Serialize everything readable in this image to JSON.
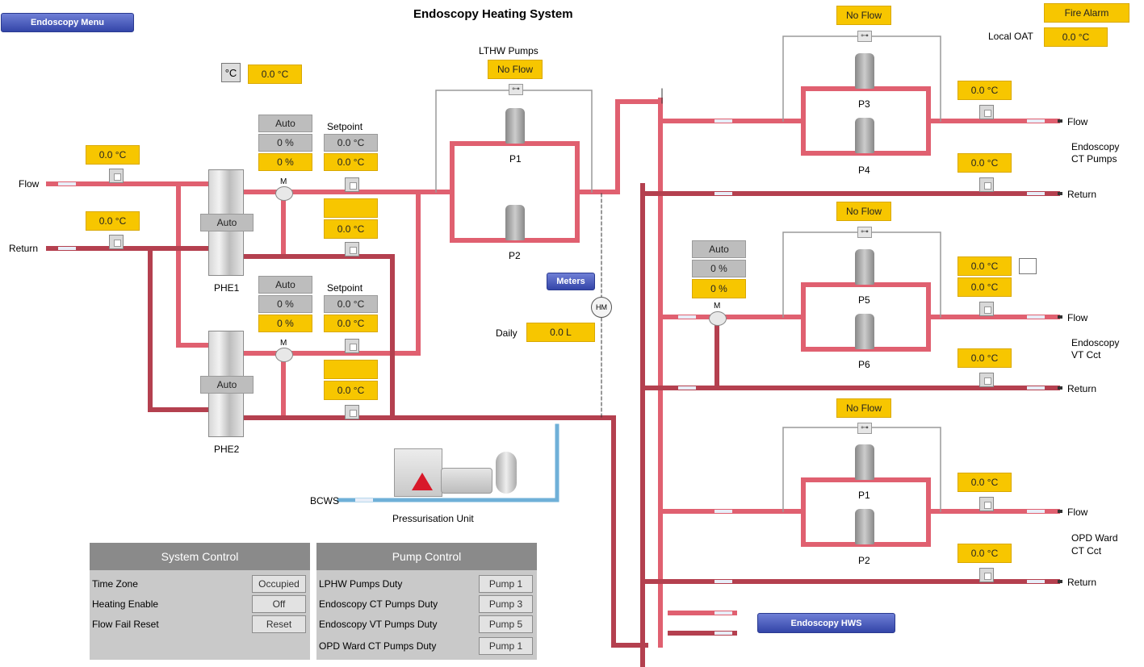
{
  "title": "Endoscopy Heating System",
  "menu_button": "Endoscopy Menu",
  "fire_alarm": "Fire Alarm",
  "local_oat": {
    "label": "Local OAT",
    "value": "0.0 °C"
  },
  "deg_icon": "°C",
  "top_temp": "0.0 °C",
  "flow_label": "Flow",
  "return_label": "Return",
  "phe_flow_temp": "0.0 °C",
  "phe_return_temp": "0.0 °C",
  "phe1": {
    "name": "PHE1",
    "mode": "Auto",
    "valve_auto": "Auto",
    "valve_pct": "0 %",
    "valve_out": "0 %",
    "setpoint_label": "Setpoint",
    "setpoint": "0.0 °C",
    "actual": "0.0 °C",
    "blank": "",
    "out_temp": "0.0 °C"
  },
  "phe2": {
    "name": "PHE2",
    "mode": "Auto",
    "valve_auto": "Auto",
    "valve_pct": "0 %",
    "valve_out": "0 %",
    "setpoint_label": "Setpoint",
    "setpoint": "0.0 °C",
    "actual": "0.0 °C",
    "blank": "",
    "out_temp": "0.0 °C"
  },
  "lthw": {
    "label": "LTHW Pumps",
    "status": "No Flow",
    "p1": "P1",
    "p2": "P2"
  },
  "meters": {
    "button": "Meters",
    "hm": "HM",
    "daily_label": "Daily",
    "daily_value": "0.0 L"
  },
  "bcws": "BCWS",
  "pressurisation": "Pressurisation Unit",
  "valve_m": "M",
  "ct": {
    "status": "No Flow",
    "p3": "P3",
    "p4": "P4",
    "flow_temp": "0.0 °C",
    "return_temp": "0.0 °C",
    "name_line1": "Endoscopy",
    "name_line2": "CT Pumps"
  },
  "vt": {
    "status": "No Flow",
    "p5": "P5",
    "p6": "P6",
    "auto": "Auto",
    "pct": "0 %",
    "out": "0 %",
    "flow_temp1": "0.0 °C",
    "flow_temp2": "0.0 °C",
    "return_temp": "0.0 °C",
    "name_line1": "Endoscopy",
    "name_line2": "VT Cct"
  },
  "opd": {
    "status": "No Flow",
    "p1": "P1",
    "p2": "P2",
    "flow_temp": "0.0 °C",
    "return_temp": "0.0 °C",
    "name_line1": "OPD Ward",
    "name_line2": "CT Cct"
  },
  "hws_button": "Endoscopy HWS",
  "system_control": {
    "title": "System Control",
    "rows": [
      {
        "label": "Time Zone",
        "value": "Occupied"
      },
      {
        "label": "Heating Enable",
        "value": "Off"
      },
      {
        "label": "Flow Fail Reset",
        "value": "Reset"
      }
    ]
  },
  "pump_control": {
    "title": "Pump Control",
    "rows": [
      {
        "label": "LPHW Pumps Duty",
        "value": "Pump 1"
      },
      {
        "label": "Endoscopy CT Pumps Duty",
        "value": "Pump 3"
      },
      {
        "label": "Endoscopy VT Pumps Duty",
        "value": "Pump 5"
      },
      {
        "label": "OPD Ward CT Pumps Duty",
        "value": "Pump 1"
      }
    ]
  },
  "colors": {
    "pipe_flow": "#d9505e",
    "pipe_return": "#b23a4a",
    "pipe_cold": "#6fb0d8",
    "value_bg": "#f7c600"
  }
}
